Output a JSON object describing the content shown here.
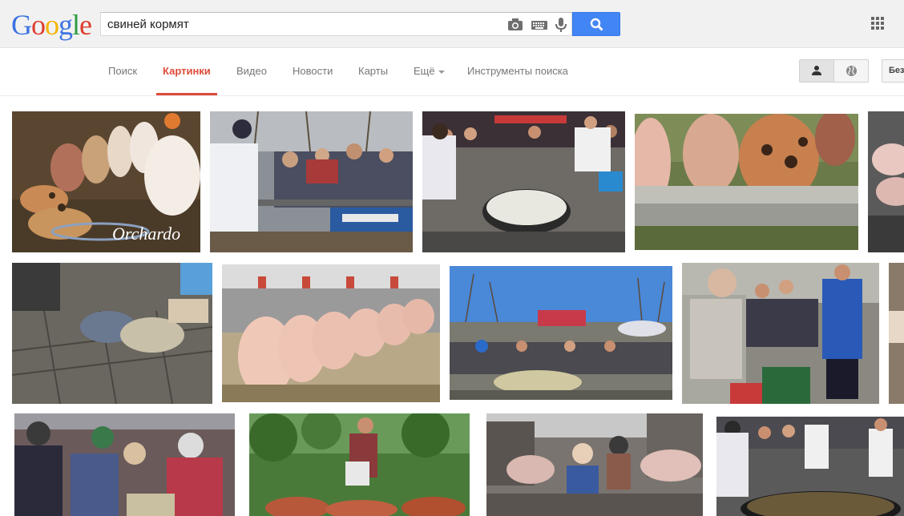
{
  "logo": {
    "letters": [
      "G",
      "o",
      "o",
      "g",
      "l",
      "e"
    ]
  },
  "search": {
    "query": "свиней кормят"
  },
  "icons": {
    "camera": "camera-icon",
    "keyboard": "keyboard-icon",
    "mic": "microphone-icon",
    "search": "search-icon",
    "apps": "apps-grid-icon",
    "personal": "person-icon",
    "world": "globe-icon"
  },
  "nav": {
    "tabs": [
      {
        "label": "Поиск"
      },
      {
        "label": "Картинки"
      },
      {
        "label": "Видео"
      },
      {
        "label": "Новости"
      },
      {
        "label": "Карты"
      },
      {
        "label": "Ещё"
      },
      {
        "label": "Инструменты поиска"
      }
    ],
    "active": "Картинки",
    "safe_search_label": "Без"
  },
  "colors": {
    "accent": "#dd4b39",
    "search_button": "#4285f4"
  },
  "results": [
    {
      "caption": "Orchardo"
    },
    {
      "caption": ""
    },
    {
      "caption": ""
    },
    {
      "caption": ""
    },
    {
      "caption": ""
    },
    {
      "caption": ""
    },
    {
      "caption": ""
    },
    {
      "caption": ""
    },
    {
      "caption": ""
    },
    {
      "caption": ""
    },
    {
      "caption": ""
    },
    {
      "caption": ""
    },
    {
      "caption": ""
    },
    {
      "caption": ""
    },
    {
      "caption": ""
    },
    {
      "caption": ""
    }
  ]
}
